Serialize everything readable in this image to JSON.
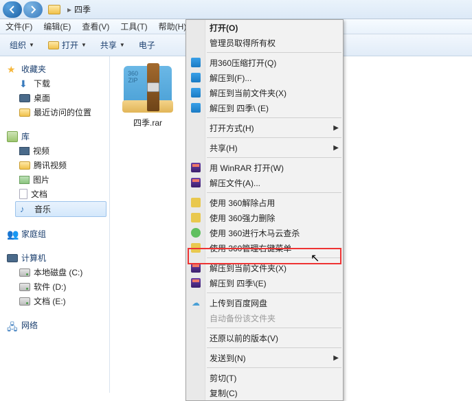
{
  "titlebar": {
    "folder": "四季"
  },
  "menubar": {
    "file": "文件(F)",
    "edit": "编辑(E)",
    "view": "查看(V)",
    "tools": "工具(T)",
    "help": "帮助(H)"
  },
  "toolbar": {
    "organize": "组织",
    "open": "打开",
    "share": "共享",
    "email": "电子"
  },
  "sidebar": {
    "favorites": {
      "header": "收藏夹",
      "items": [
        "下载",
        "桌面",
        "最近访问的位置"
      ]
    },
    "libraries": {
      "header": "库",
      "items": [
        "视频",
        "腾讯视频",
        "图片",
        "文档",
        "音乐"
      ]
    },
    "homegroup": {
      "header": "家庭组"
    },
    "computer": {
      "header": "计算机",
      "items": [
        "本地磁盘 (C:)",
        "软件 (D:)",
        "文档 (E:)"
      ]
    },
    "network": {
      "header": "网络"
    }
  },
  "content": {
    "file_name": "四季.rar",
    "zip_tag": "360\nZIP"
  },
  "ctx": {
    "items": [
      {
        "label": "打开(O)",
        "bold": true
      },
      {
        "label": "管理员取得所有权"
      },
      {
        "sep": true
      },
      {
        "label": "用360压缩打开(Q)",
        "icon": "360"
      },
      {
        "label": "解压到(F)...",
        "icon": "360"
      },
      {
        "label": "解压到当前文件夹(X)",
        "icon": "360"
      },
      {
        "label": "解压到 四季\\ (E)",
        "icon": "360"
      },
      {
        "sep": true
      },
      {
        "label": "打开方式(H)",
        "submenu": true
      },
      {
        "sep": true
      },
      {
        "label": "共享(H)",
        "submenu": true
      },
      {
        "sep": true
      },
      {
        "label": "用 WinRAR 打开(W)",
        "icon": "rar"
      },
      {
        "label": "解压文件(A)...",
        "icon": "rar"
      },
      {
        "sep": true
      },
      {
        "label": "使用 360解除占用",
        "icon": "y"
      },
      {
        "label": "使用 360强力删除",
        "icon": "y"
      },
      {
        "label": "使用 360进行木马云查杀",
        "icon": "g"
      },
      {
        "label": "使用 360管理右键菜单",
        "icon": "y"
      },
      {
        "sep": true
      },
      {
        "label": "解压到当前文件夹(X)",
        "icon": "rar",
        "highlighted": true
      },
      {
        "label": "解压到 四季\\(E)",
        "icon": "rar"
      },
      {
        "sep": true
      },
      {
        "label": "上传到百度网盘",
        "icon": "cloud"
      },
      {
        "label": "自动备份该文件夹",
        "disabled": true
      },
      {
        "sep": true
      },
      {
        "label": "还原以前的版本(V)"
      },
      {
        "sep": true
      },
      {
        "label": "发送到(N)",
        "submenu": true
      },
      {
        "sep": true
      },
      {
        "label": "剪切(T)"
      },
      {
        "label": "复制(C)"
      }
    ]
  }
}
